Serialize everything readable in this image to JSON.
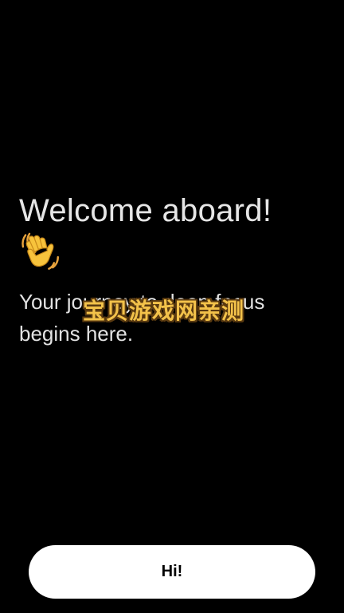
{
  "welcome": {
    "title": "Welcome aboard!",
    "emoji_icon": "waving-hand-icon",
    "subtitle": "Your journey to deep focus begins here."
  },
  "watermark": {
    "text": "宝贝游戏网亲测"
  },
  "actions": {
    "primary_label": "Hi!"
  },
  "colors": {
    "background": "#000000",
    "text": "#e6e6e6",
    "button_bg": "#ffffff",
    "button_text": "#000000",
    "watermark": "#f3c24a"
  }
}
